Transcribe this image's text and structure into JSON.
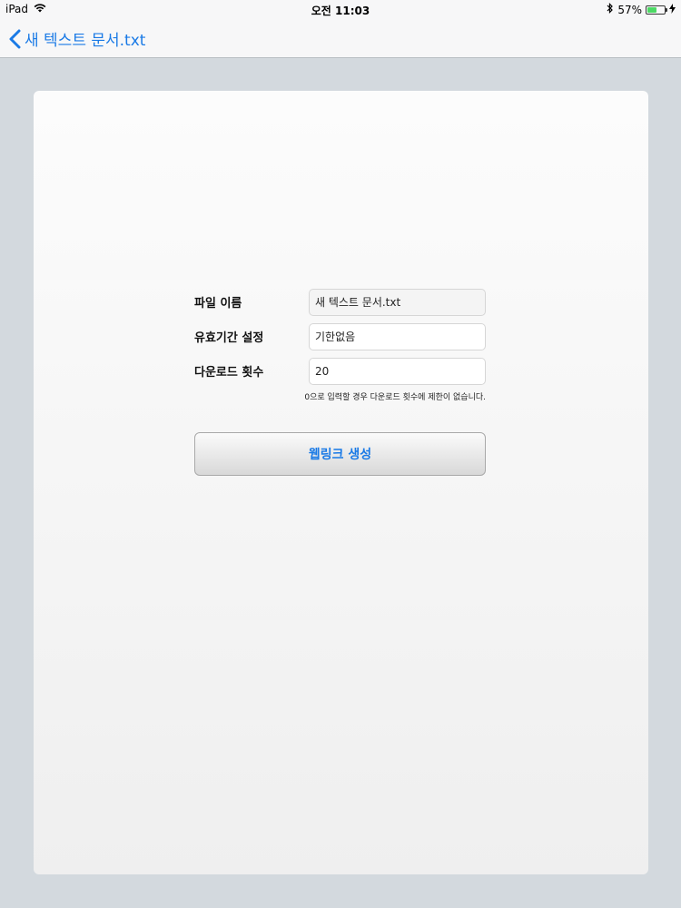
{
  "status": {
    "device": "iPad",
    "time": "오전 11:03",
    "battery": "57%",
    "battery_level": 0.57
  },
  "nav": {
    "back_title": "새 텍스트 문서.txt"
  },
  "form": {
    "filename_label": "파일 이름",
    "filename_value": "새 텍스트 문서.txt",
    "expiry_label": "유효기간 설정",
    "expiry_value": "기한없음",
    "download_label": "다운로드 횟수",
    "download_value": "20",
    "download_hint": "0으로 입력할 경우 다운로드 횟수에 제한이 없습니다.",
    "create_button": "웹링크 생성"
  },
  "colors": {
    "accent": "#1a7ae6",
    "background": "#d3d9de"
  }
}
